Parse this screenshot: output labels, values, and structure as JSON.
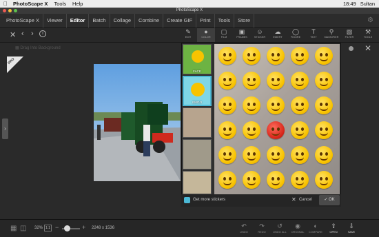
{
  "menubar": {
    "apple": "",
    "app": "PhotoScape X",
    "menus": [
      "Tools",
      "Help"
    ],
    "clock": "18:49",
    "user": "Sultan"
  },
  "window": {
    "title": "PhotoScape X"
  },
  "tabs": [
    "PhotoScape X",
    "Viewer",
    "Editor",
    "Batch",
    "Collage",
    "Combine",
    "Create GIF",
    "Print",
    "Tools",
    "Store"
  ],
  "active_tab": "Editor",
  "toolbar": {
    "items": [
      {
        "label": "EDIT",
        "icon": "edit-icon"
      },
      {
        "label": "COLOR",
        "icon": "color-icon"
      },
      {
        "label": "FILM",
        "icon": "film-icon"
      },
      {
        "label": "FRAMES",
        "icon": "frames-icon"
      },
      {
        "label": "STICKER",
        "icon": "sticker-icon"
      },
      {
        "label": "INSERT",
        "icon": "insert-icon"
      },
      {
        "label": "FIGURE",
        "icon": "figure-icon"
      },
      {
        "label": "TEXT",
        "icon": "text-icon"
      },
      {
        "label": "MAGNIFIER",
        "icon": "magnifier-icon"
      },
      {
        "label": "FILTER",
        "icon": "filter-icon"
      },
      {
        "label": "TOOLS",
        "icon": "tools-icon"
      }
    ]
  },
  "canvas": {
    "search_placeholder": "Drag Into Background",
    "pro_badge": "PRO"
  },
  "stickers": {
    "categories": [
      "FACE",
      "EMOJI",
      "",
      "",
      "",
      ""
    ],
    "get_more": "Get more stickers",
    "cancel": "Cancel",
    "ok": "OK"
  },
  "status": {
    "zoom": "32%",
    "one_to_one": "1:1",
    "dimensions": "2248 x 1536"
  },
  "bottom_actions": [
    {
      "label": "UNDO",
      "icon": "undo-icon"
    },
    {
      "label": "REDO",
      "icon": "redo-icon"
    },
    {
      "label": "UNDO ALL",
      "icon": "undo-all-icon"
    },
    {
      "label": "ORIGINAL",
      "icon": "original-icon"
    },
    {
      "label": "COMPARE",
      "icon": "compare-icon"
    },
    {
      "label": "OPEN",
      "icon": "open-icon"
    },
    {
      "label": "SAVE",
      "icon": "save-icon"
    }
  ]
}
